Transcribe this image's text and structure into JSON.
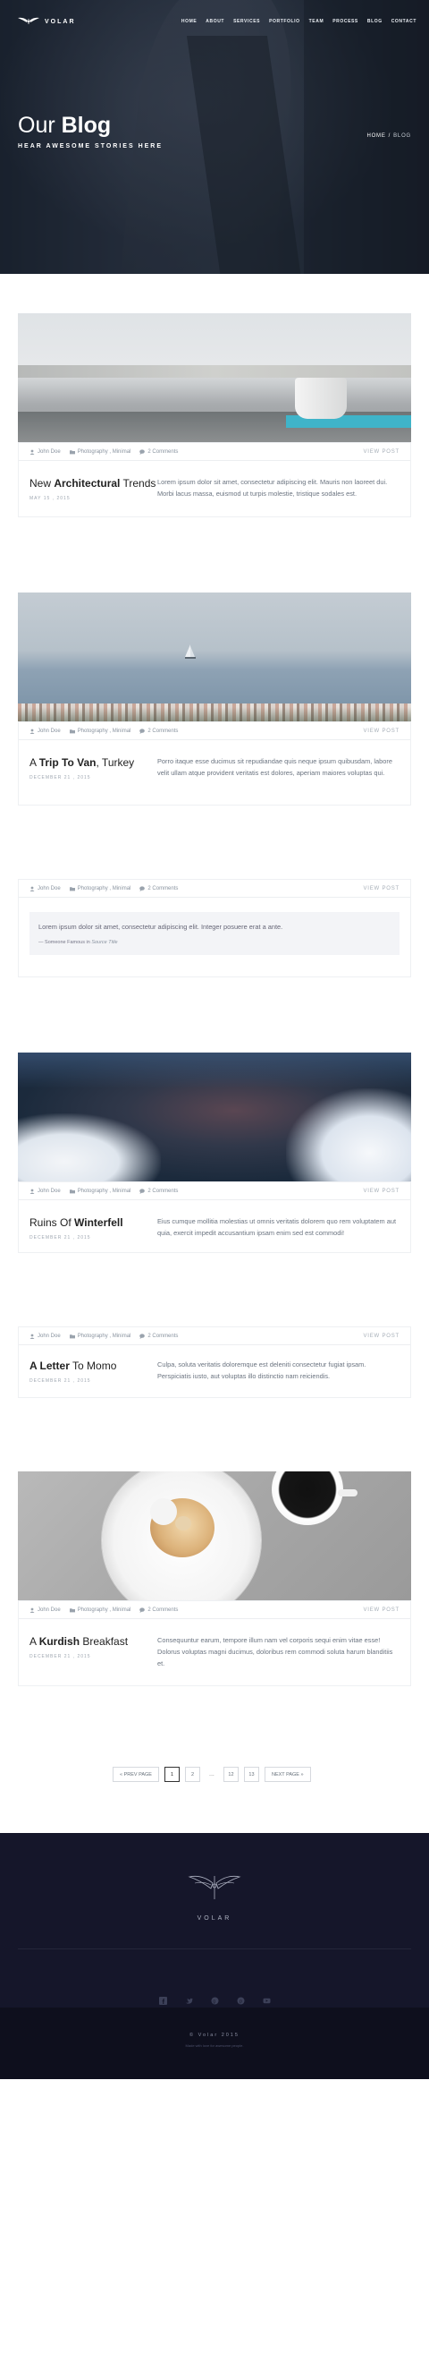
{
  "brand": {
    "name": "VOLAR"
  },
  "nav": {
    "items": [
      "HOME",
      "ABOUT",
      "SERVICES",
      "PORTFOLIO",
      "TEAM",
      "PROCESS",
      "BLOG",
      "CONTACT"
    ]
  },
  "hero": {
    "title_light": "Our ",
    "title_bold": "Blog",
    "subtitle": "HEAR AWESOME STORIES HERE",
    "crumb_home": "HOME",
    "crumb_sep": "/",
    "crumb_current": "BLOG"
  },
  "posts": [
    {
      "author": "John Doe",
      "category": "Photography , Minimal",
      "comments": "2 Comments",
      "view": "VIEW POST",
      "title_pre": "New ",
      "title_bold": "Architectural",
      "title_post": " Trends",
      "date": "MAY 15 , 2015",
      "excerpt": "Lorem ipsum dolor sit amet, consectetur adipiscing elit. Mauris non laoreet dui. Morbi lacus massa, euismod ut turpis molestie, tristique sodales est."
    },
    {
      "author": "John Doe",
      "category": "Photography , Minimal",
      "comments": "2 Comments",
      "view": "VIEW POST",
      "title_pre": "A ",
      "title_bold": "Trip To Van",
      "title_post": ", Turkey",
      "date": "DECEMBER 21 , 2015",
      "excerpt": "Porro itaque esse ducimus sit repudiandae quis neque ipsum quibusdam, labore velit ullam atque provident veritatis est dolores, aperiam maiores voluptas qui."
    },
    {
      "author": "John Doe",
      "category": "Photography , Minimal",
      "comments": "2 Comments",
      "view": "VIEW POST",
      "quote": "Lorem ipsum dolor sit amet, consectetur adipiscing elit. Integer posuere erat a ante.",
      "quote_source": "— Someone Famous in ",
      "quote_title": "Source Title"
    },
    {
      "author": "John Doe",
      "category": "Photography , Minimal",
      "comments": "2 Comments",
      "view": "VIEW POST",
      "title_pre": "Ruins Of ",
      "title_bold": "Winterfell",
      "title_post": "",
      "date": "DECEMBER 21 , 2015",
      "excerpt": "Eius cumque mollitia molestias ut omnis veritatis dolorem quo rem voluptatem aut quia, exercit impedit accusantium ipsam enim sed est commodi!"
    },
    {
      "author": "John Doe",
      "category": "Photography , Minimal",
      "comments": "2 Comments",
      "view": "VIEW POST",
      "title_pre": "",
      "title_bold": "A Letter",
      "title_post": " To Momo",
      "date": "DECEMBER 21 , 2015",
      "excerpt": "Culpa, soluta veritatis doloremque est deleniti consectetur fugiat ipsam. Perspiciatis iusto, aut voluptas illo distinctio nam reiciendis."
    },
    {
      "author": "John Doe",
      "category": "Photography , Minimal",
      "comments": "2 Comments",
      "view": "VIEW POST",
      "title_pre": "A ",
      "title_bold": "Kurdish",
      "title_post": " Breakfast",
      "date": "DECEMBER 21 , 2015",
      "excerpt": "Consequuntur earum, tempore illum nam vel corporis sequi enim vitae esse! Dolorus voluptas magni ducimus, doloribus rem commodi soluta harum blanditiis et."
    }
  ],
  "pagination": {
    "prev": "« PREV PAGE",
    "pages": [
      "1",
      "2",
      "12",
      "13"
    ],
    "dots": "...",
    "next": "NEXT PAGE »",
    "current": "1"
  },
  "footer": {
    "name": "VOLAR",
    "socials": [
      "facebook-icon",
      "twitter-icon",
      "google-plus-icon",
      "pinterest-icon",
      "youtube-icon"
    ],
    "copyright": "© Volar 2015",
    "note": "Made with love for awesome people."
  },
  "colors": {
    "footer": "#15162a",
    "footer_bottom": "#0e0f1d",
    "hero_dark": "#1c2532"
  }
}
